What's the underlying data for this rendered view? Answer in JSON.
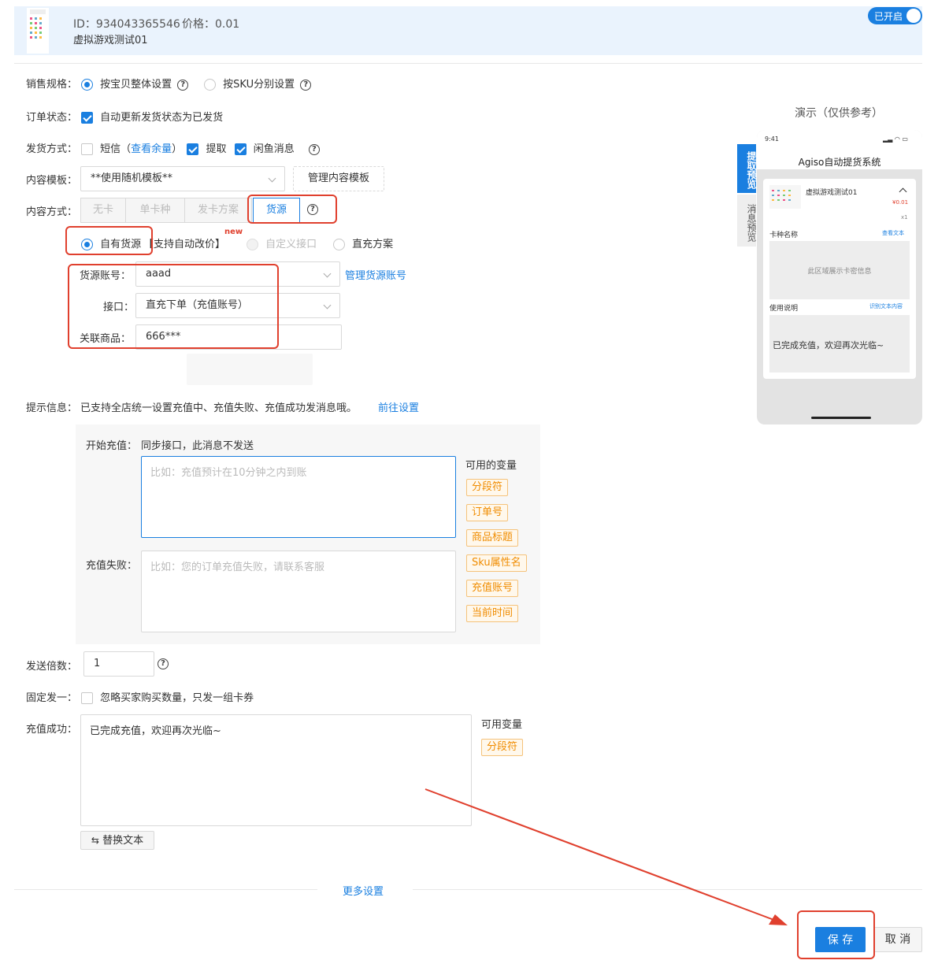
{
  "product": {
    "id_text": "ID：934043365546",
    "price_text": "价格：0.01",
    "name": "虚拟游戏测试01",
    "toggle_label": "已开启"
  },
  "sales_spec": {
    "label": "销售规格：",
    "opt1": "按宝贝整体设置",
    "opt2": "按SKU分别设置"
  },
  "order_status": {
    "label": "订单状态：",
    "option": "自动更新发货状态为已发货"
  },
  "delivery": {
    "label": "发货方式：",
    "sms": "短信（",
    "sms_link": "查看余量",
    "sms_close": "）",
    "pickup": "提取",
    "xianyu": "闲鱼消息"
  },
  "content_template": {
    "label": "内容模板：",
    "value": "**使用随机模板**",
    "manage_button": "管理内容模板"
  },
  "content_mode": {
    "label": "内容方式：",
    "tabs": [
      "无卡",
      "单卡种",
      "发卡方案",
      "货源"
    ]
  },
  "source_options": {
    "own": "自有货源",
    "bracket": "【支持自动改价】",
    "new_badge": "new",
    "custom": "自定义接口",
    "direct": "直充方案"
  },
  "source_account": {
    "label": "货源账号：",
    "value": "aaad",
    "manage_link": "管理货源账号"
  },
  "interface": {
    "label": "接口：",
    "value": "直充下单（充值账号）"
  },
  "linked_product": {
    "label": "关联商品：",
    "value": "666***"
  },
  "tip": {
    "label": "提示信息：",
    "text": "已支持全店统一设置充值中、充值失败、充值成功发消息哦。",
    "link": "前往设置"
  },
  "start_recharge": {
    "label": "开始充值：",
    "note": "同步接口，此消息不发送",
    "placeholder": "比如：充值预计在10分钟之内到账"
  },
  "recharge_fail": {
    "label": "充值失败：",
    "placeholder": "比如：您的订单充值失败，请联系客服"
  },
  "variables": {
    "title": "可用的变量",
    "items": [
      "分段符",
      "订单号",
      "商品标题",
      "Sku属性名",
      "充值账号",
      "当前时间"
    ]
  },
  "send_multiplier": {
    "label": "发送倍数：",
    "value": "1"
  },
  "fixed_one": {
    "label": "固定发一：",
    "option": "忽略买家购买数量，只发一组卡券"
  },
  "recharge_success": {
    "label": "充值成功：",
    "value": "已完成充值，欢迎再次光临~",
    "var_title": "可用变量",
    "var_item": "分段符",
    "replace_button": "替换文本"
  },
  "more_settings": "更多设置",
  "actions": {
    "save": "保 存",
    "cancel": "取 消"
  },
  "preview": {
    "title": "演示（仅供参考）",
    "time": "9:41",
    "app_title": "Agiso自动提货系统",
    "product_name": "虚拟游戏测试01",
    "price": "¥0.01",
    "qty": "x1",
    "card_label": "卡种名称",
    "card_link": "查看文本",
    "card_placeholder": "此区域展示卡密信息",
    "usage_label": "使用说明",
    "usage_link": "识别文本内容",
    "usage_text": "已完成充值，欢迎再次光临~",
    "side_tab1": "提取预览",
    "side_tab2": "消息预览"
  },
  "colors": {
    "accent": "#1a7fe0",
    "annotation": "#e0402e",
    "tag": "#f08c00"
  }
}
